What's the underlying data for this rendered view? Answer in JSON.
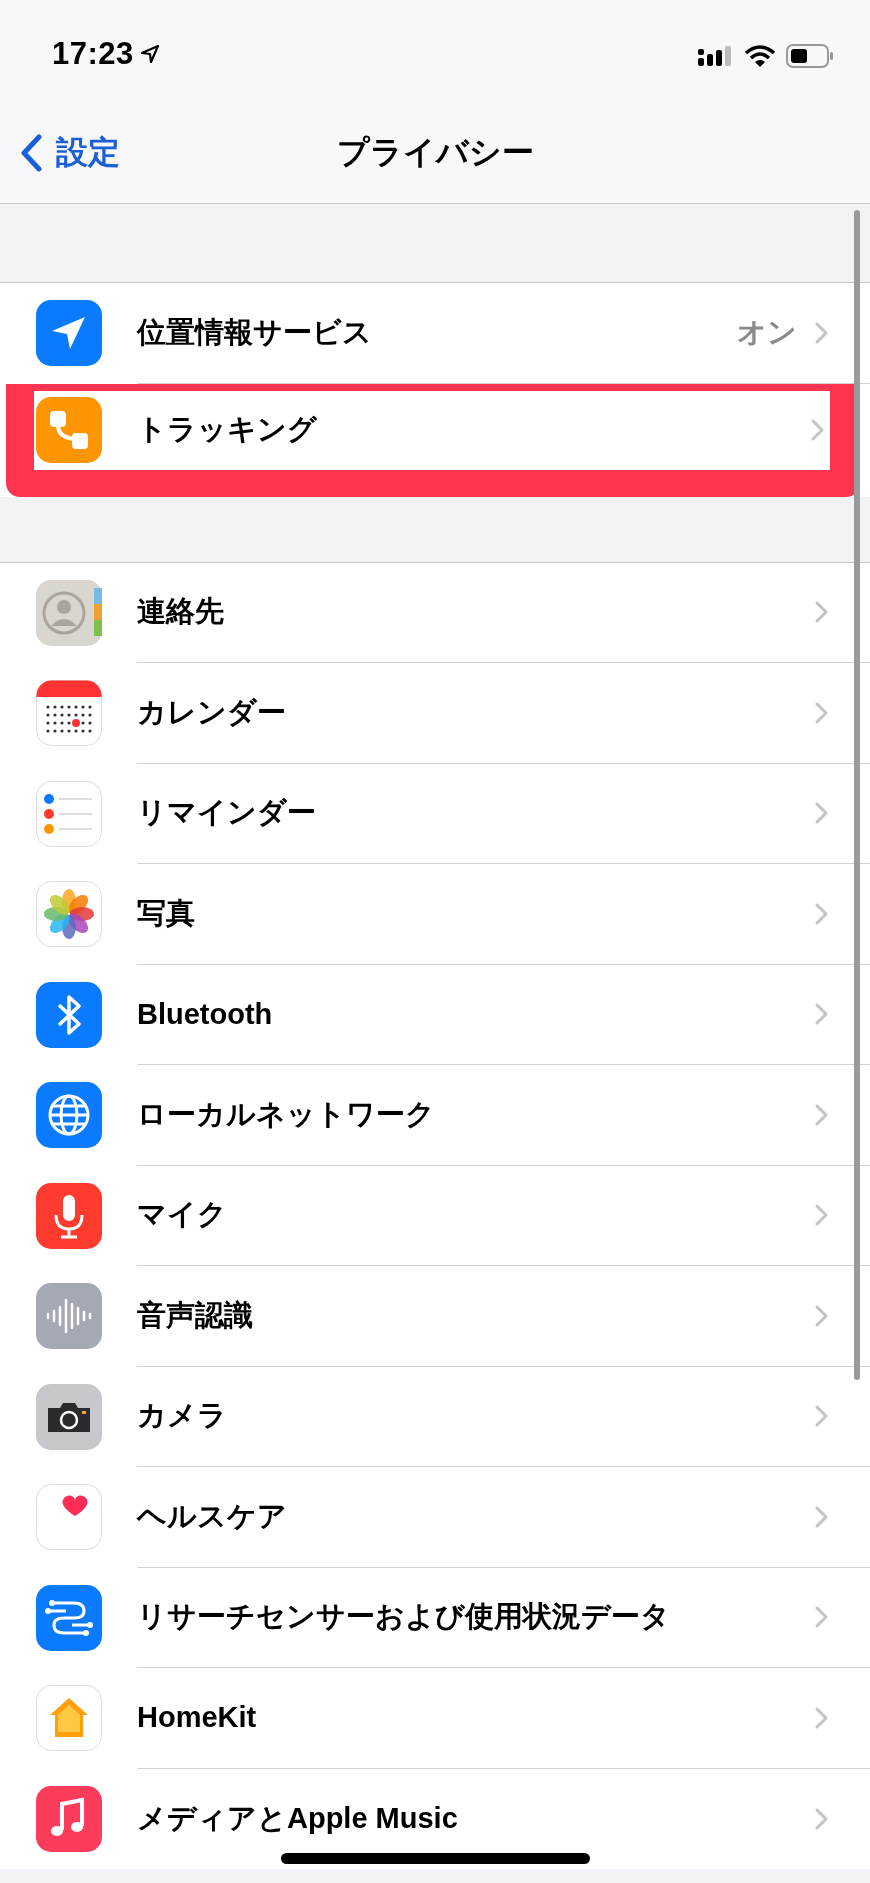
{
  "status_bar": {
    "time": "17:23"
  },
  "nav_bar": {
    "back": "設定",
    "title": "プライバシー"
  },
  "sections": [
    {
      "rows": [
        {
          "label": "位置情報サービス",
          "value": "オン",
          "highlighted": false
        },
        {
          "label": "トラッキング",
          "highlighted": true
        }
      ]
    },
    {
      "rows": [
        {
          "label": "連絡先",
          "highlighted": false
        },
        {
          "label": "カレンダー",
          "highlighted": false
        },
        {
          "label": "リマインダー",
          "highlighted": false
        },
        {
          "label": "写真",
          "highlighted": false
        },
        {
          "label": "Bluetooth",
          "highlighted": false
        },
        {
          "label": "ローカルネットワーク",
          "highlighted": false
        },
        {
          "label": "マイク",
          "highlighted": false
        },
        {
          "label": "音声認識",
          "highlighted": false
        },
        {
          "label": "カメラ",
          "highlighted": false
        },
        {
          "label": "ヘルスケア",
          "highlighted": false
        },
        {
          "label": "リサーチセンサーおよび使用状況データ",
          "highlighted": false
        },
        {
          "label": "HomeKit",
          "highlighted": false
        },
        {
          "label": "メディアとApple Music",
          "highlighted": false
        }
      ]
    }
  ]
}
